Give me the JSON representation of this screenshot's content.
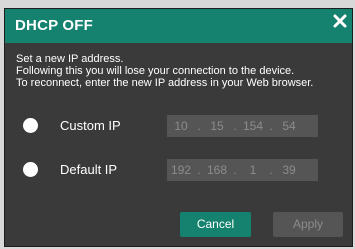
{
  "dialog": {
    "title": "DHCP OFF",
    "message_lines": [
      "Set a new IP address.",
      "Following this you will lose your connection to the device.",
      "To reconnect, enter the new IP address in your Web browser."
    ]
  },
  "options": [
    {
      "label": "Custom IP",
      "ip": [
        "10",
        "15",
        "154",
        "54"
      ]
    },
    {
      "label": "Default IP",
      "ip": [
        "192",
        "168",
        "1",
        "39"
      ]
    }
  ],
  "ip_separator": ".",
  "buttons": {
    "cancel_label": "Cancel",
    "apply_label": "Apply"
  },
  "colors": {
    "accent": "#14826e",
    "panel": "#3a3a3a",
    "field": "#555555",
    "disabled_text": "#8c8c8c"
  },
  "icons": {
    "close": "close-icon",
    "radio": "radio-button-icon"
  }
}
